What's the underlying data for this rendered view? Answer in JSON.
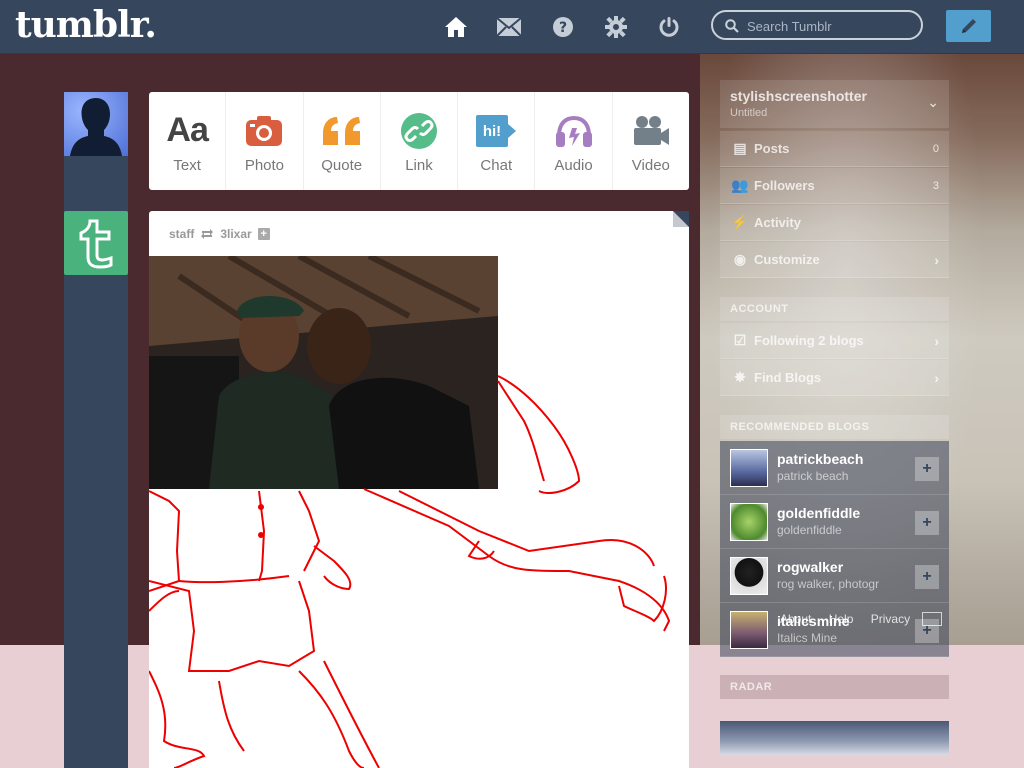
{
  "header": {
    "logo": "tumblr.",
    "search_placeholder": "Search Tumblr",
    "nav_icons": [
      "home-icon",
      "mail-icon",
      "help-icon",
      "gear-icon",
      "power-icon"
    ],
    "compose_icon": "pencil-icon",
    "bg_color": "#36465d",
    "accent": "#529ecc"
  },
  "post_types": [
    {
      "label": "Text",
      "icon": "text-icon",
      "color": "#444444"
    },
    {
      "label": "Photo",
      "icon": "camera-icon",
      "color": "#d95e40"
    },
    {
      "label": "Quote",
      "icon": "quote-icon",
      "color": "#f2992e"
    },
    {
      "label": "Link",
      "icon": "link-icon",
      "color": "#56bc8a"
    },
    {
      "label": "Chat",
      "icon": "chat-icon",
      "color": "#529ecc"
    },
    {
      "label": "Audio",
      "icon": "headphones-icon",
      "color": "#a77dc2"
    },
    {
      "label": "Video",
      "icon": "video-camera-icon",
      "color": "#748089"
    }
  ],
  "post": {
    "author": "staff",
    "reblogged_from": "3lixar",
    "reblog_icon": "reblog-icon"
  },
  "sidebar": {
    "blog_name": "stylishscreenshotter",
    "blog_subtitle": "Untitled",
    "rows": [
      {
        "label": "Posts",
        "count": "0",
        "icon": "posts-icon"
      },
      {
        "label": "Followers",
        "count": "3",
        "icon": "followers-icon"
      },
      {
        "label": "Activity",
        "icon": "activity-icon"
      },
      {
        "label": "Customize",
        "icon": "eye-icon"
      }
    ],
    "account_title": "ACCOUNT",
    "account_rows": [
      {
        "label": "Following 2 blogs",
        "icon": "following-icon"
      },
      {
        "label": "Find Blogs",
        "icon": "find-blogs-icon"
      }
    ],
    "recommended_title": "RECOMMENDED BLOGS",
    "recommended": [
      {
        "name": "patrickbeach",
        "desc": "patrick beach"
      },
      {
        "name": "goldenfiddle",
        "desc": "goldenfiddle"
      },
      {
        "name": "rogwalker",
        "desc": "rog walker, photogr"
      },
      {
        "name": "italicsmine",
        "desc": "Italics Mine"
      }
    ],
    "footer_links": [
      "About",
      "Help",
      "Privacy"
    ],
    "radar_title": "RADAR"
  }
}
